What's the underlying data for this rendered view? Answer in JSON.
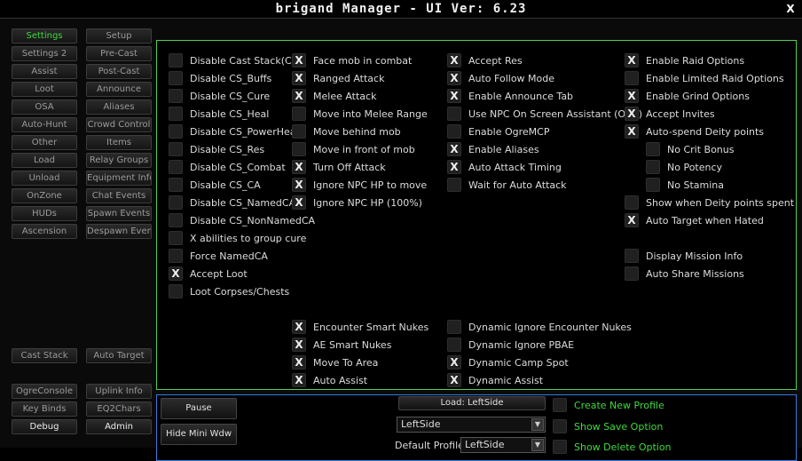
{
  "window": {
    "title": "brigand Manager  - UI Ver: 6.23",
    "close": "X"
  },
  "nav": {
    "settings": "Settings",
    "setup": "Setup",
    "settings2": "Settings 2",
    "precast": "Pre-Cast",
    "assist": "Assist",
    "postcast": "Post-Cast",
    "loot": "Loot",
    "announce": "Announce",
    "osa": "OSA",
    "aliases": "Aliases",
    "autohunt": "Auto-Hunt",
    "crowdcontrol": "Crowd Control",
    "other": "Other",
    "items": "Items",
    "load": "Load",
    "relaygroups": "Relay Groups",
    "unload": "Unload",
    "equipmentinfo": "Equipment Info",
    "onzone": "OnZone",
    "chatevents": "Chat Events",
    "huds": "HUDs",
    "spawnevents": "Spawn Events",
    "ascension": "Ascension",
    "despawnevents": "Despawn Events",
    "caststack": "Cast Stack",
    "autotarget": "Auto Target",
    "ogreconsole": "OgreConsole",
    "uplinkinfo": "Uplink Info",
    "keybinds": "Key Binds",
    "eq2chars": "EQ2Chars",
    "debug": "Debug",
    "admin": "Admin"
  },
  "col1": [
    {
      "label": "Disable Cast Stack(CS)",
      "checked": false
    },
    {
      "label": "Disable CS_Buffs",
      "checked": false
    },
    {
      "label": "Disable CS_Cure",
      "checked": false
    },
    {
      "label": "Disable CS_Heal",
      "checked": false
    },
    {
      "label": "Disable CS_PowerHeal",
      "checked": false
    },
    {
      "label": "Disable CS_Res",
      "checked": false
    },
    {
      "label": "Disable CS_Combat",
      "checked": false
    },
    {
      "label": "Disable CS_CA",
      "checked": false
    },
    {
      "label": "Disable CS_NamedCA",
      "checked": false
    },
    {
      "label": "Disable CS_NonNamedCA",
      "checked": false
    },
    {
      "label": "X abilities to group cure",
      "checked": false
    },
    {
      "label": "Force NamedCA",
      "checked": false
    },
    {
      "label": "Accept Loot",
      "checked": true
    },
    {
      "label": "Loot Corpses/Chests",
      "checked": false
    }
  ],
  "col2": [
    {
      "label": "Face mob in combat",
      "checked": true
    },
    {
      "label": "Ranged Attack",
      "checked": true
    },
    {
      "label": "Melee Attack",
      "checked": true
    },
    {
      "label": "Move into Melee Range",
      "checked": false
    },
    {
      "label": "Move behind mob",
      "checked": false
    },
    {
      "label": "Move in front of mob",
      "checked": false
    },
    {
      "label": "Turn Off Attack",
      "checked": true
    },
    {
      "label": "Ignore NPC HP to move",
      "checked": true
    },
    {
      "label": "Ignore NPC HP (100%)",
      "checked": true
    }
  ],
  "col3": [
    {
      "label": "Accept Res",
      "checked": true
    },
    {
      "label": "Auto Follow Mode",
      "checked": true
    },
    {
      "label": "Enable Announce Tab",
      "checked": true
    },
    {
      "label": "Use NPC On Screen Assistant (OSA)",
      "checked": false
    },
    {
      "label": "Enable OgreMCP",
      "checked": false
    },
    {
      "label": "Enable Aliases",
      "checked": true
    },
    {
      "label": "Auto Attack Timing",
      "checked": true
    },
    {
      "label": "Wait for Auto Attack",
      "checked": false
    }
  ],
  "col4": [
    {
      "label": "Enable Raid Options",
      "checked": true
    },
    {
      "label": "Enable Limited Raid Options",
      "checked": false
    },
    {
      "label": "Enable Grind Options",
      "checked": true
    },
    {
      "label": "Accept Invites",
      "checked": true
    },
    {
      "label": "Auto-spend Deity points",
      "checked": true
    }
  ],
  "col4sub": [
    {
      "label": "No Crit Bonus",
      "checked": false
    },
    {
      "label": "No Potency",
      "checked": false
    },
    {
      "label": "No Stamina",
      "checked": false
    }
  ],
  "col4b": [
    {
      "label": "Show when Deity points spent",
      "checked": false
    },
    {
      "label": "Auto Target when Hated",
      "checked": true
    }
  ],
  "col4c": [
    {
      "label": "Display Mission Info",
      "checked": false
    },
    {
      "label": "Auto Share Missions",
      "checked": false
    }
  ],
  "lower2": [
    {
      "label": "Encounter Smart Nukes",
      "checked": true
    },
    {
      "label": "AE Smart Nukes",
      "checked": true
    },
    {
      "label": "Move To Area",
      "checked": true
    },
    {
      "label": "Auto Assist",
      "checked": true
    }
  ],
  "lower3": [
    {
      "label": "Dynamic Ignore Encounter Nukes",
      "checked": false
    },
    {
      "label": "Dynamic Ignore PBAE",
      "checked": false
    },
    {
      "label": "Dynamic Camp Spot",
      "checked": true
    },
    {
      "label": "Dynamic Assist",
      "checked": true
    }
  ],
  "bottom": {
    "pause": "Pause",
    "hide_mini": "Hide Mini Wdw",
    "load_btn": "Load: LeftSide",
    "profile_value": "LeftSide",
    "default_profile_label": "Default Profile:",
    "default_profile_value": "LeftSide",
    "create_new": "Create New Profile",
    "show_save": "Show Save Option",
    "show_delete": "Show Delete Option",
    "arrow": "▼"
  },
  "check_mark": "X"
}
